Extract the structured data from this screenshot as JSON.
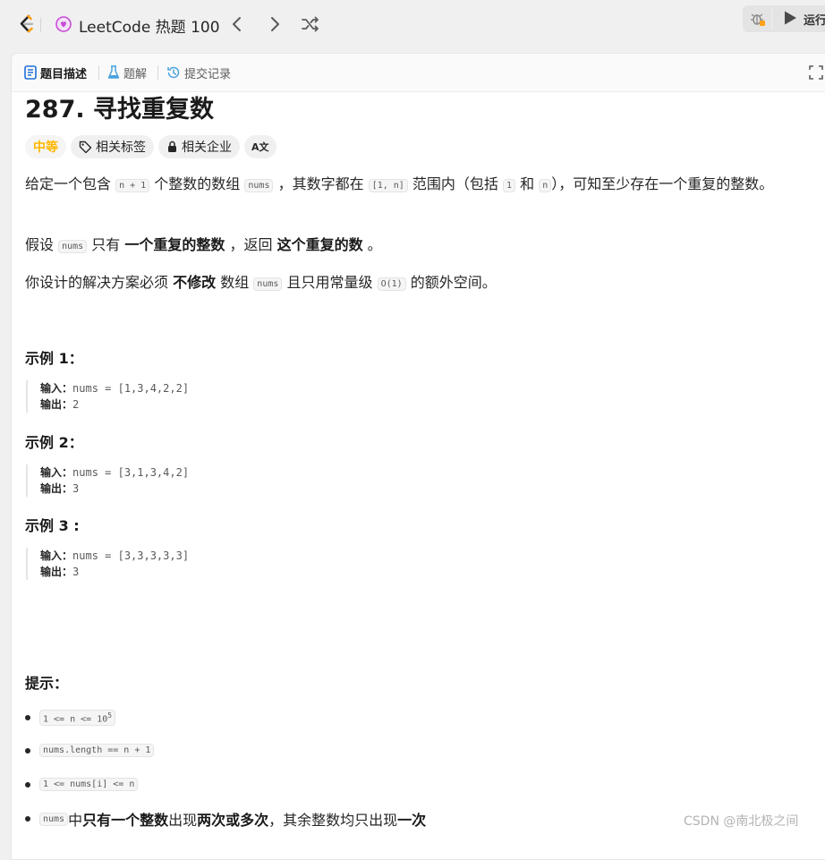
{
  "topbar": {
    "problem_list_title": "LeetCode 热题 100",
    "run_label": "运行",
    "colors": {
      "logo_orange": "#FFA116",
      "logo_dark": "#262626",
      "heart_purple": "#c84bd6"
    }
  },
  "tabs": [
    {
      "label": "题目描述",
      "icon": "description-icon",
      "active": true
    },
    {
      "label": "题解",
      "icon": "flask-icon",
      "active": false
    },
    {
      "label": "提交记录",
      "icon": "history-icon",
      "active": false
    }
  ],
  "problem": {
    "title": "287. 寻找重复数",
    "difficulty": "中等",
    "difficulty_color": "#FFB800",
    "tags": [
      {
        "label": "相关标签",
        "icon": "tag-icon"
      },
      {
        "label": "相关企业",
        "icon": "lock-icon"
      }
    ],
    "translate_glyph": "A文",
    "description": {
      "p1": {
        "t1": "给定一个包含 ",
        "c1": "n + 1",
        "t2": " 个整数的数组 ",
        "c2": "nums",
        "t3": " ，其数字都在 ",
        "c3": "[1, n]",
        "t4": " 范围内（包括 ",
        "c4": "1",
        "t5": " 和 ",
        "c5": "n",
        "t6": "），可知至少存在一个重复的整数。"
      },
      "p2": {
        "t1": "假设 ",
        "c1": "nums",
        "t2": " 只有 ",
        "b1": "一个重复的整数",
        "t3": " ，返回 ",
        "b2": "这个重复的数",
        "t4": " 。"
      },
      "p3": {
        "t1": "你设计的解决方案必须 ",
        "b1": "不修改",
        "t2": " 数组 ",
        "c1": "nums",
        "t3": " 且只用常量级 ",
        "c2": "O(1)",
        "t4": " 的额外空间。"
      }
    },
    "examples": [
      {
        "title": "示例 1：",
        "input_label": "输入：",
        "input": "nums = [1,3,4,2,2]",
        "output_label": "输出：",
        "output": "2"
      },
      {
        "title": "示例 2：",
        "input_label": "输入：",
        "input": "nums = [3,1,3,4,2]",
        "output_label": "输出：",
        "output": "3"
      },
      {
        "title": "示例 3 :",
        "input_label": "输入：",
        "input": "nums = [3,3,3,3,3]",
        "output_label": "输出：",
        "output": "3"
      }
    ],
    "constraints_title": "提示：",
    "constraints": {
      "c1_code": "1 <= n <= 10",
      "c1_sup": "5",
      "c2_code": "nums.length == n + 1",
      "c3_code": "1 <= nums[i] <= n",
      "c4": {
        "code": "nums",
        "t1": " 中 ",
        "b1": "只有一个整数",
        "t2": " 出现 ",
        "b2": "两次或多次",
        "t3": " ，其余整数均只出现 ",
        "b3": "一次"
      }
    }
  },
  "watermark": "CSDN @南北极之间"
}
